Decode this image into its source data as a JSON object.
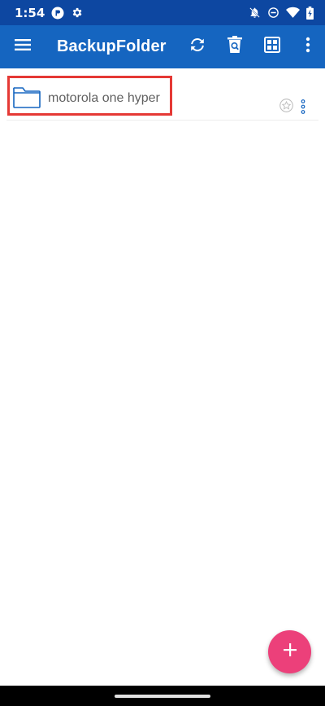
{
  "status_bar": {
    "time": "1:54",
    "left_icons": [
      "notification-app-icon",
      "settings-gear-icon"
    ],
    "right_icons": [
      "notifications-off-icon",
      "do-not-disturb-icon",
      "wifi-icon",
      "battery-charging-icon"
    ]
  },
  "app_bar": {
    "title": "BackupFolder",
    "actions": [
      "menu-icon",
      "sync-icon",
      "trash-search-icon",
      "grid-view-icon",
      "more-vert-icon"
    ]
  },
  "files": [
    {
      "name": "motorola one hyper",
      "type": "folder",
      "starred": false
    }
  ],
  "fab": {
    "icon": "add-icon",
    "label": "+"
  },
  "colors": {
    "status_bar": "#0d47a1",
    "app_bar": "#1565c0",
    "fab": "#ec407a",
    "highlight": "#e53935",
    "folder": "#1565c0"
  }
}
